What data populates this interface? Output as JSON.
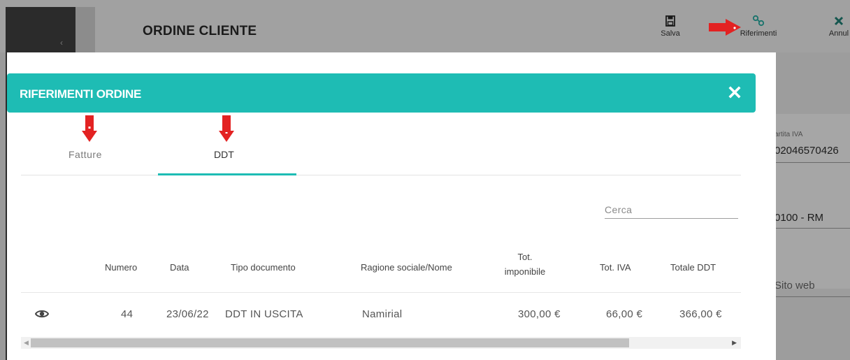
{
  "page": {
    "title": "ORDINE CLIENTE"
  },
  "toolbar": {
    "save_label": "Salva",
    "references_label": "Riferimenti",
    "cancel_label": "Annul"
  },
  "background_form": {
    "vat_label": "artita IVA",
    "vat_value": "02046570426",
    "city_value": "0100 - RM",
    "website_label": "Sito web"
  },
  "modal": {
    "title": "RIFERIMENTI ORDINE",
    "tabs": [
      {
        "label": "Fatture",
        "active": false
      },
      {
        "label": "DDT",
        "active": true
      }
    ],
    "search_placeholder": "Cerca",
    "columns": {
      "numero": "Numero",
      "data": "Data",
      "tipo": "Tipo documento",
      "ragione": "Ragione sociale/Nome",
      "tot_imponibile": [
        "Tot.",
        "imponibile"
      ],
      "tot_iva": "Tot. IVA",
      "totale_ddt": "Totale DDT"
    },
    "rows": [
      {
        "numero": "44",
        "data": "23/06/22",
        "tipo": "DDT IN USCITA",
        "ragione": "Namirial",
        "tot_imponibile": "300,00 €",
        "tot_iva": "66,00 €",
        "totale_ddt": "366,00 €"
      }
    ]
  },
  "colors": {
    "accent": "#1ebcb4",
    "annotation_arrow": "#e32222"
  },
  "icons": [
    "chevron-left-icon",
    "save-icon",
    "link-icon",
    "close-icon",
    "eye-icon",
    "red-arrow-icon"
  ]
}
